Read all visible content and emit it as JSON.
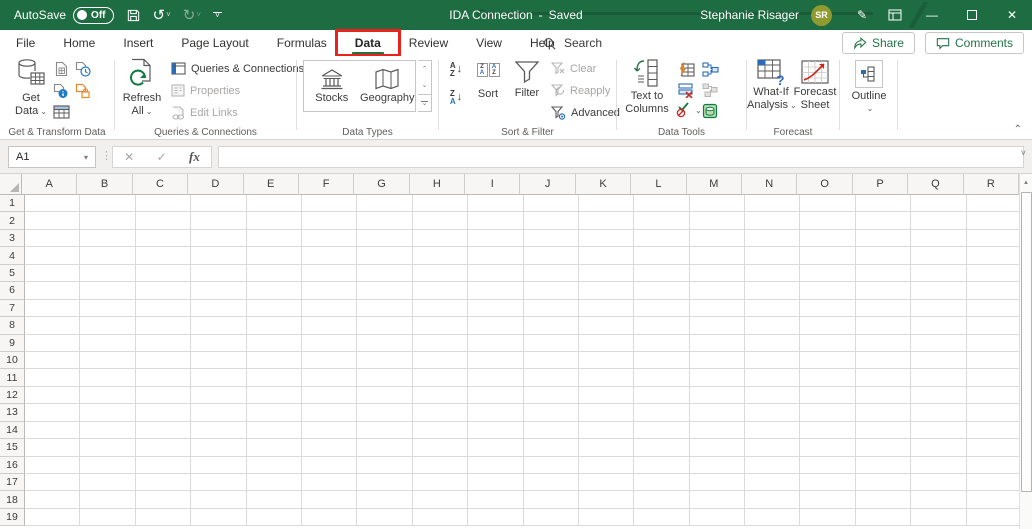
{
  "glyphs": {
    "chevron_down": "⌄",
    "chevron_up": "⌃",
    "dropdown_arrow": "▾",
    "small_down": "˅",
    "ellipsis_v": "⋮",
    "cancel": "✕",
    "check": "✓",
    "undo": "↺",
    "redo": "↻",
    "pen": "✎",
    "minimize": "—",
    "close": "✕",
    "triangle_up": "▲",
    "arrow_down": "↓",
    "letter_a": "A",
    "letter_z": "Z",
    "gear": "⚙",
    "question": "?"
  },
  "window": {
    "autosave_label": "AutoSave",
    "autosave_state": "Off",
    "title": "IDA Connection",
    "title_separator": "-",
    "title_status": "Saved",
    "user_name": "Stephanie Risager",
    "user_initials": "SR"
  },
  "menu": {
    "tabs": [
      "File",
      "Home",
      "Insert",
      "Page Layout",
      "Formulas",
      "Data",
      "Review",
      "View",
      "Help"
    ],
    "active_tab": "Data",
    "search_label": "Search",
    "share_label": "Share",
    "comments_label": "Comments"
  },
  "ribbon": {
    "get_transform": {
      "group_label": "Get & Transform Data",
      "get_data_label": "Get Data"
    },
    "queries": {
      "group_label": "Queries & Connections",
      "refresh_all_label": "Refresh All",
      "queries_connections_label": "Queries & Connections",
      "properties_label": "Properties",
      "edit_links_label": "Edit Links"
    },
    "data_types": {
      "group_label": "Data Types",
      "stocks_label": "Stocks",
      "geography_label": "Geography"
    },
    "sort_filter": {
      "group_label": "Sort & Filter",
      "sort_label": "Sort",
      "filter_label": "Filter",
      "clear_label": "Clear",
      "reapply_label": "Reapply",
      "advanced_label": "Advanced"
    },
    "data_tools": {
      "group_label": "Data Tools",
      "text_to_columns_label": "Text to Columns"
    },
    "forecast": {
      "group_label": "Forecast",
      "what_if_label": "What-If Analysis",
      "forecast_sheet_label": "Forecast Sheet"
    },
    "outline": {
      "outline_label": "Outline"
    }
  },
  "formula_bar": {
    "name_box_value": "A1",
    "fx_label": "fx",
    "formula_value": ""
  },
  "grid": {
    "columns": [
      "A",
      "B",
      "C",
      "D",
      "E",
      "F",
      "G",
      "H",
      "I",
      "J",
      "K",
      "L",
      "M",
      "N",
      "O",
      "P",
      "Q",
      "R"
    ],
    "rows": [
      "1",
      "2",
      "3",
      "4",
      "5",
      "6",
      "7",
      "8",
      "9",
      "10",
      "11",
      "12",
      "13",
      "14",
      "15",
      "16",
      "17",
      "18",
      "19"
    ]
  },
  "colors": {
    "titlebar_green": "#1e6c41",
    "accent_green": "#217346",
    "highlight_red": "#e8231d",
    "avatar_olive": "#8f9a2f"
  }
}
